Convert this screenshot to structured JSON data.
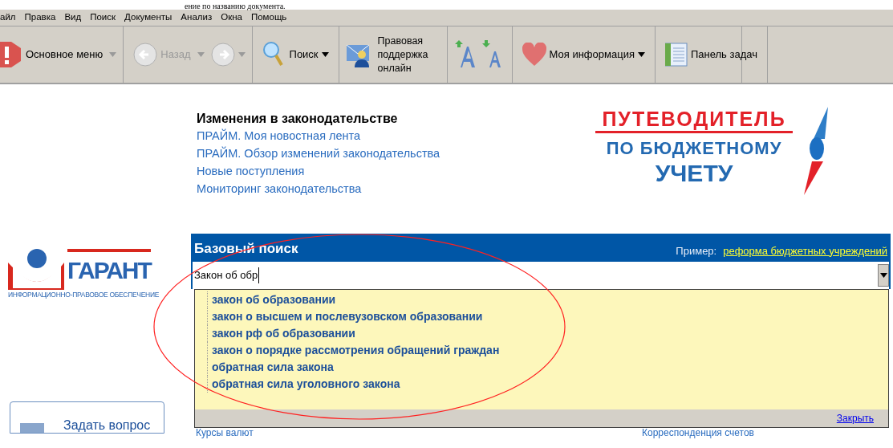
{
  "document_caption": "ение по названию документа.",
  "menu_bar": [
    "айл",
    "Правка",
    "Вид",
    "Поиск",
    "Документы",
    "Анализ",
    "Окна",
    "Помощь"
  ],
  "toolbar": [
    {
      "kind": "main",
      "label": "Основное меню"
    },
    {
      "kind": "back",
      "label": "Назад",
      "disabled": true
    },
    {
      "kind": "forward",
      "disabled": true
    },
    {
      "kind": "search",
      "label": "Поиск"
    },
    {
      "kind": "support",
      "label": "Правовая поддержка онлайн"
    },
    {
      "kind": "font"
    },
    {
      "kind": "info",
      "label": "Моя информация"
    },
    {
      "kind": "tasks",
      "label": "Панель задач"
    }
  ],
  "changes": {
    "title": "Изменения в законодательстве",
    "links": [
      "ПРАЙМ. Моя новостная лента",
      "ПРАЙМ. Обзор изменений законодательства",
      "Новые поступления",
      "Мониторинг законодательства"
    ]
  },
  "guide_logo": {
    "line_1": "ПУТЕВОДИТЕЛЬ",
    "line_2": "ПО БЮДЖЕТНОМУ",
    "line_3": "УЧЕТУ"
  },
  "garant_logo": {
    "name": "ГАРАНТ",
    "tagline": "ИНФОРМАЦИОННО-ПРАВОВОЕ ОБЕСПЕЧЕНИЕ"
  },
  "search": {
    "title": "Базовый поиск",
    "example_label": "Пример:",
    "example_link": "реформа бюджетных учреждений",
    "value": "Закон об обр",
    "suggestions": [
      "закон об образовании",
      "закон о высшем и послевузовском образовании",
      "закон рф об образовании",
      "закон о порядке рассмотрения обращений граждан",
      "обратная сила закона",
      "обратная сила уголовного закона"
    ],
    "close": "Закрыть"
  },
  "bottom": {
    "ask": "Задать вопрос",
    "rates": "Курсы валют",
    "accounts": "Корреспонденция счетов"
  }
}
